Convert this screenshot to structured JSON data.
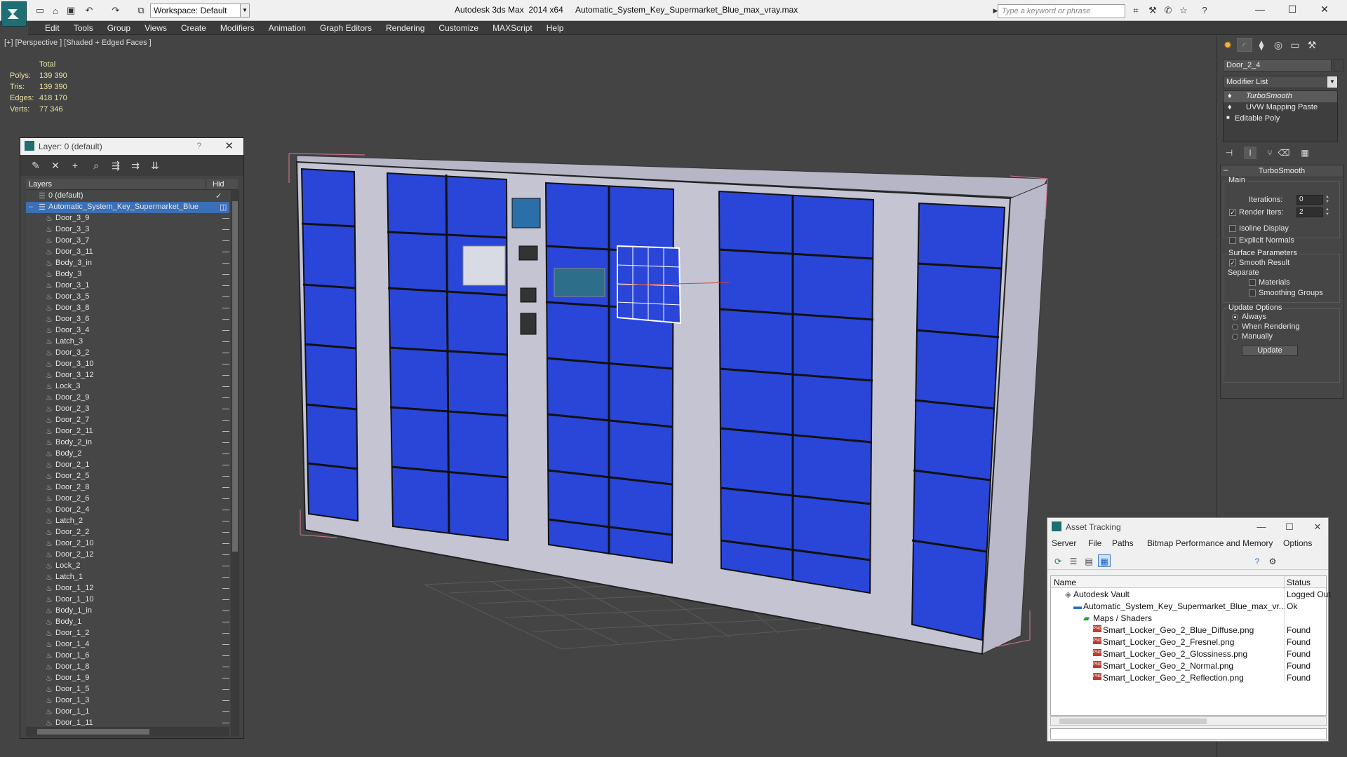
{
  "title_bar": {
    "app_title": "Autodesk 3ds Max  2014 x64",
    "file_title": "Automatic_System_Key_Supermarket_Blue_max_vray.max",
    "workspace": "Workspace: Default",
    "search_placeholder": "Type a keyword or phrase"
  },
  "menu": [
    "Edit",
    "Tools",
    "Group",
    "Views",
    "Create",
    "Modifiers",
    "Animation",
    "Graph Editors",
    "Rendering",
    "Customize",
    "MAXScript",
    "Help"
  ],
  "viewport": {
    "label": "[+] [Perspective ] [Shaded + Edged Faces ]",
    "stats": {
      "header": "Total",
      "rows": [
        {
          "label": "Polys:",
          "value": "139 390"
        },
        {
          "label": "Tris:",
          "value": "139 390"
        },
        {
          "label": "Edges:",
          "value": "418 170"
        },
        {
          "label": "Verts:",
          "value": "77 346"
        }
      ]
    }
  },
  "layer_window": {
    "title": "Layer: 0 (default)",
    "help": "?",
    "col_layers": "Layers",
    "col_hide": "Hid",
    "default_layer": "0 (default)",
    "selected_layer": "Automatic_System_Key_Supermarket_Blue",
    "objects": [
      "Door_3_9",
      "Door_3_3",
      "Door_3_7",
      "Door_3_11",
      "Body_3_in",
      "Body_3",
      "Door_3_1",
      "Door_3_5",
      "Door_3_8",
      "Door_3_6",
      "Door_3_4",
      "Latch_3",
      "Door_3_2",
      "Door_3_10",
      "Door_3_12",
      "Lock_3",
      "Door_2_9",
      "Door_2_3",
      "Door_2_7",
      "Door_2_11",
      "Body_2_in",
      "Body_2",
      "Door_2_1",
      "Door_2_5",
      "Door_2_8",
      "Door_2_6",
      "Door_2_4",
      "Latch_2",
      "Door_2_2",
      "Door_2_10",
      "Door_2_12",
      "Lock_2",
      "Latch_1",
      "Door_1_12",
      "Door_1_10",
      "Body_1_in",
      "Body_1",
      "Door_1_2",
      "Door_1_4",
      "Door_1_6",
      "Door_1_8",
      "Door_1_9",
      "Door_1_5",
      "Door_1_3",
      "Door_1_1",
      "Door_1_11"
    ]
  },
  "command_panel": {
    "object_name": "Door_2_4",
    "modifier_list": "Modifier List",
    "stack": [
      "TurboSmooth",
      "UVW Mapping Paste",
      "Editable Poly"
    ],
    "rollout_title": "TurboSmooth",
    "main_group": "Main",
    "iterations_label": "Iterations:",
    "iterations_value": "0",
    "render_iters_label": "Render Iters:",
    "render_iters_value": "2",
    "isoline": "Isoline Display",
    "explicit_normals": "Explicit Normals",
    "surface_group": "Surface Parameters",
    "smooth_result": "Smooth Result",
    "separate": "Separate",
    "materials": "Materials",
    "smoothing_groups": "Smoothing Groups",
    "update_group": "Update Options",
    "always": "Always",
    "when_rendering": "When Rendering",
    "manually": "Manually",
    "update_button": "Update"
  },
  "asset_tracking": {
    "title": "Asset Tracking",
    "menu": [
      "Server",
      "File",
      "Paths",
      "Bitmap Performance and Memory",
      "Options"
    ],
    "col_name": "Name",
    "col_status": "Status",
    "rows": [
      {
        "name": "Autodesk Vault",
        "status": "Logged Out"
      },
      {
        "name": "Automatic_System_Key_Supermarket_Blue_max_vr...",
        "status": "Ok"
      },
      {
        "name": "Maps / Shaders",
        "status": ""
      },
      {
        "name": "Smart_Locker_Geo_2_Blue_Diffuse.png",
        "status": "Found"
      },
      {
        "name": "Smart_Locker_Geo_2_Fresnel.png",
        "status": "Found"
      },
      {
        "name": "Smart_Locker_Geo_2_Glossiness.png",
        "status": "Found"
      },
      {
        "name": "Smart_Locker_Geo_2_Normal.png",
        "status": "Found"
      },
      {
        "name": "Smart_Locker_Geo_2_Reflection.png",
        "status": "Found"
      }
    ]
  },
  "colors": {
    "locker_blue": "#2a46d8",
    "selection": "#3b6fb6",
    "app_teal": "#1e6e72"
  }
}
